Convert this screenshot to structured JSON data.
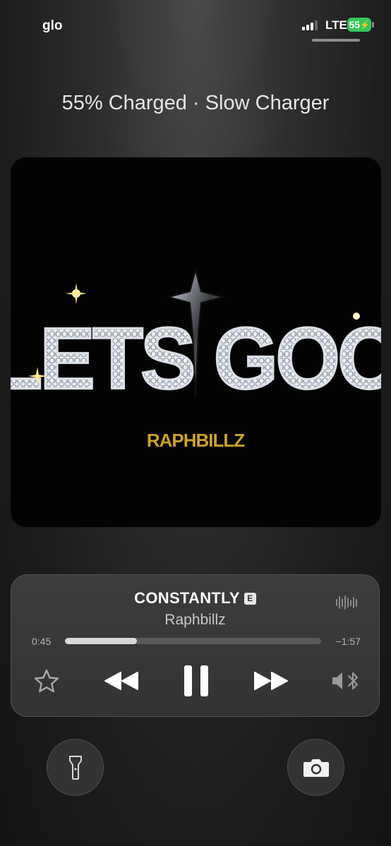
{
  "status_bar": {
    "carrier": "glo",
    "network": "LTE",
    "battery": "55",
    "signal_bars": 3
  },
  "lockscreen": {
    "charge_status": "55% Charged · Slow Charger"
  },
  "artwork": {
    "title_text": "LETS GOO",
    "artist_text": "RAPHBILLZ"
  },
  "now_playing": {
    "title": "CONSTANTLY",
    "explicit_badge": "E",
    "artist": "Raphbillz",
    "elapsed": "0:45",
    "remaining": "−1:57",
    "progress": 0.28
  },
  "icons": {
    "favorite": "star-icon",
    "previous": "rewind-icon",
    "playpause": "pause-icon",
    "next": "fast-forward-icon",
    "output": "bluetooth-speaker-icon",
    "waveform": "waveform-icon",
    "flashlight": "flashlight-icon",
    "camera": "camera-icon"
  },
  "colors": {
    "battery": "#35c759",
    "gold": "#c9a227"
  }
}
